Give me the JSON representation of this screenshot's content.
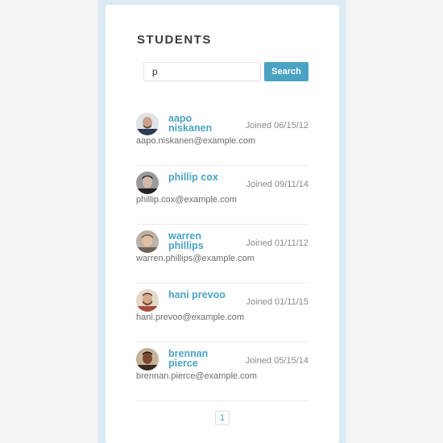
{
  "header": {
    "title": "STUDENTS"
  },
  "search": {
    "value": "p",
    "button_label": "Search"
  },
  "students": [
    {
      "name": "aapo niskanen",
      "joined": "Joined 06/15/12",
      "email": "aapo.niskanen@example.com",
      "avatar": "avatar-photo-bald-man-icon"
    },
    {
      "name": "phillip cox",
      "joined": "Joined 09/11/14",
      "email": "phillip.cox@example.com",
      "avatar": "avatar-photo-dark-hair-man-icon"
    },
    {
      "name": "warren phillips",
      "joined": "Joined 01/11/12",
      "email": "warren.phillips@example.com",
      "avatar": "avatar-photo-smiling-man-icon"
    },
    {
      "name": "hani prevoo",
      "joined": "Joined 01/11/15",
      "email": "hani.prevoo@example.com",
      "avatar": "avatar-photo-bearded-man-icon"
    },
    {
      "name": "brennan pierce",
      "joined": "Joined 05/15/14",
      "email": "brennan.pierce@example.com",
      "avatar": "avatar-photo-dark-skin-man-icon"
    }
  ],
  "pagination": {
    "current_page": "1"
  },
  "colors": {
    "accent": "#4ba3c4",
    "frame": "#dcebf3",
    "background": "#f4f4f4"
  }
}
